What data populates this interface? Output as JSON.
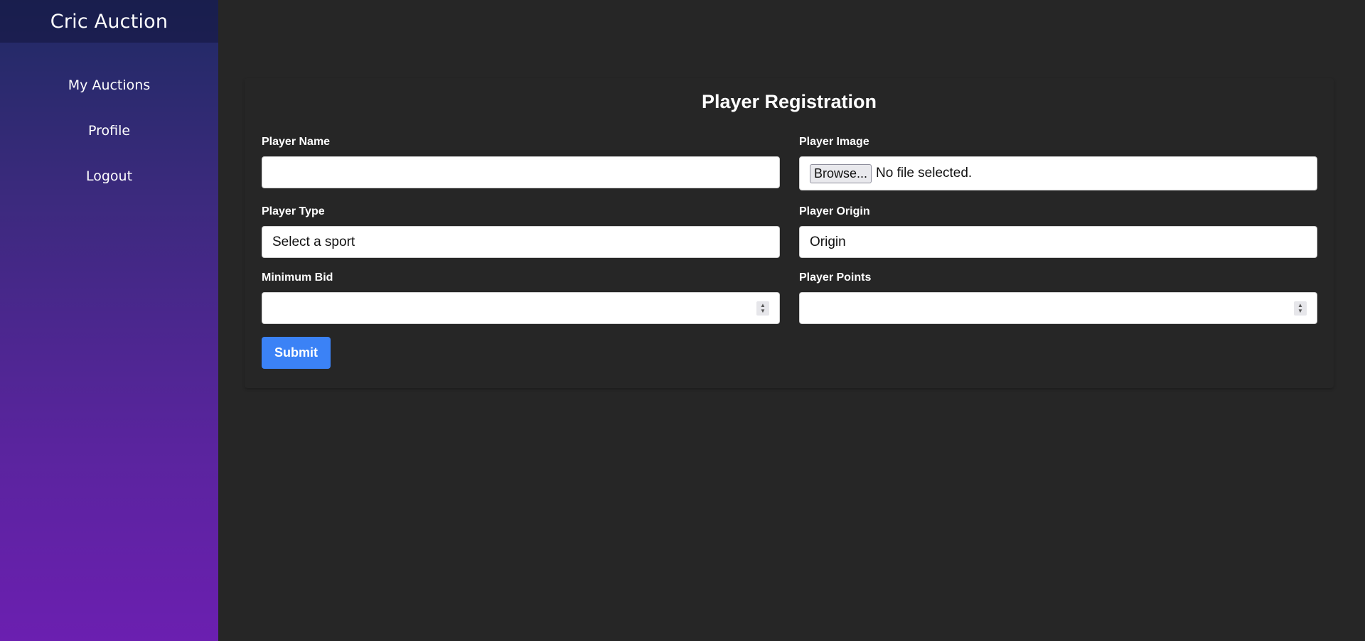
{
  "sidebar": {
    "brand": "Cric Auction",
    "items": [
      {
        "label": "My Auctions"
      },
      {
        "label": "Profile"
      },
      {
        "label": "Logout"
      }
    ]
  },
  "form": {
    "title": "Player Registration",
    "player_name": {
      "label": "Player Name",
      "value": ""
    },
    "player_image": {
      "label": "Player Image",
      "button": "Browse...",
      "status": "No file selected."
    },
    "player_type": {
      "label": "Player Type",
      "selected": "Select a sport"
    },
    "player_origin": {
      "label": "Player Origin",
      "placeholder": "Origin"
    },
    "minimum_bid": {
      "label": "Minimum Bid",
      "value": ""
    },
    "player_points": {
      "label": "Player Points",
      "value": ""
    },
    "submit_label": "Submit"
  },
  "colors": {
    "background": "#262626",
    "sidebar_top": "#1f2a63",
    "sidebar_bottom": "#6b1fb0",
    "accent": "#3b82f6"
  }
}
